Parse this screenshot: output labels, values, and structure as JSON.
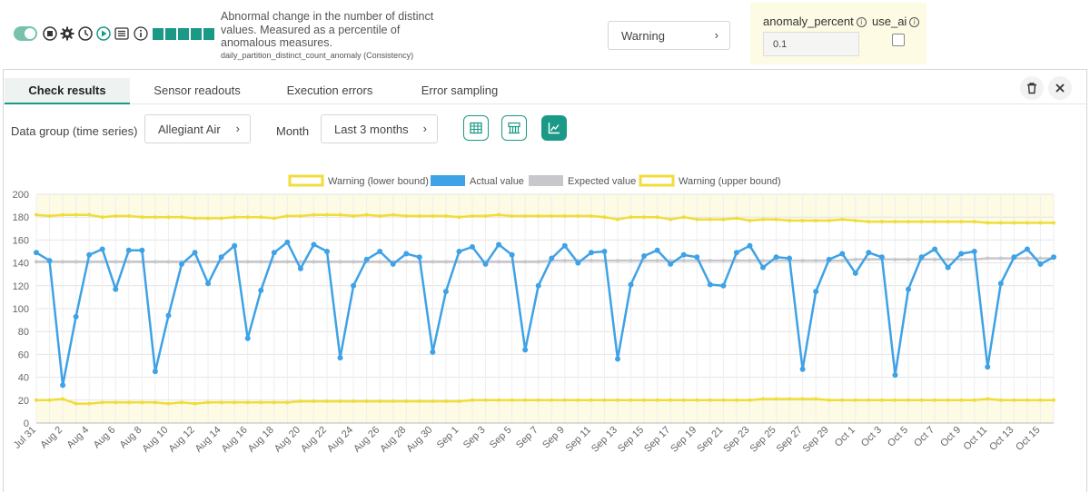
{
  "check": {
    "description": "Abnormal change in the number of distinct values. Measured as a percentile of anomalous measures.",
    "name": "daily_partition_distinct_count_anomaly",
    "category": "(Consistency)",
    "severity": "Warning",
    "params": [
      {
        "label": "anomaly_percent",
        "value": "0.1"
      },
      {
        "label": "use_ai"
      }
    ],
    "icons": [
      "toggle-on-icon",
      "stop-icon",
      "gear-icon",
      "clock-icon",
      "run-icon",
      "list-icon",
      "info-icon"
    ]
  },
  "tabs": [
    "Check results",
    "Sensor readouts",
    "Execution errors",
    "Error sampling"
  ],
  "filters": {
    "data_group_label": "Data group (time series)",
    "data_group_value": "Allegiant Air",
    "month_label": "Month",
    "month_value": "Last 3 months"
  },
  "colors": {
    "accent": "#1a9a86",
    "actual": "#3ea2e6",
    "expected": "#c8c8cc",
    "warning": "#f0dd3c",
    "band": "#fdfbe3"
  },
  "chart_data": {
    "type": "line",
    "legend": [
      "Warning (lower bound)",
      "Actual value",
      "Expected value",
      "Warning (upper bound)"
    ],
    "legend_position": "top",
    "ylim": [
      0,
      200
    ],
    "yticks": [
      0,
      20,
      40,
      60,
      80,
      100,
      120,
      140,
      160,
      180,
      200
    ],
    "grid": true,
    "x": [
      "Jul 31",
      "Aug 1",
      "Aug 2",
      "Aug 3",
      "Aug 4",
      "Aug 5",
      "Aug 6",
      "Aug 7",
      "Aug 8",
      "Aug 9",
      "Aug 10",
      "Aug 11",
      "Aug 12",
      "Aug 13",
      "Aug 14",
      "Aug 15",
      "Aug 16",
      "Aug 17",
      "Aug 18",
      "Aug 19",
      "Aug 20",
      "Aug 21",
      "Aug 22",
      "Aug 23",
      "Aug 24",
      "Aug 25",
      "Aug 26",
      "Aug 27",
      "Aug 28",
      "Aug 29",
      "Aug 30",
      "Aug 31",
      "Sep 1",
      "Sep 2",
      "Sep 3",
      "Sep 4",
      "Sep 5",
      "Sep 6",
      "Sep 7",
      "Sep 8",
      "Sep 9",
      "Sep 10",
      "Sep 11",
      "Sep 12",
      "Sep 13",
      "Sep 14",
      "Sep 15",
      "Sep 16",
      "Sep 17",
      "Sep 18",
      "Sep 19",
      "Sep 20",
      "Sep 21",
      "Sep 22",
      "Sep 23",
      "Sep 24",
      "Sep 25",
      "Sep 26",
      "Sep 27",
      "Sep 28",
      "Sep 29",
      "Sep 30",
      "Oct 1",
      "Oct 2",
      "Oct 3",
      "Oct 4",
      "Oct 5",
      "Oct 6",
      "Oct 7",
      "Oct 8",
      "Oct 9",
      "Oct 10",
      "Oct 11",
      "Oct 12",
      "Oct 13",
      "Oct 14",
      "Oct 15",
      "Oct 16"
    ],
    "x_tick_labels": [
      "Jul 31",
      "Aug 2",
      "Aug 4",
      "Aug 6",
      "Aug 8",
      "Aug 10",
      "Aug 12",
      "Aug 14",
      "Aug 16",
      "Aug 18",
      "Aug 20",
      "Aug 22",
      "Aug 24",
      "Aug 26",
      "Aug 28",
      "Aug 30",
      "Sep 1",
      "Sep 3",
      "Sep 5",
      "Sep 7",
      "Sep 9",
      "Sep 11",
      "Sep 13",
      "Sep 15",
      "Sep 17",
      "Sep 19",
      "Sep 21",
      "Sep 23",
      "Sep 25",
      "Sep 27",
      "Sep 29",
      "Oct 1",
      "Oct 3",
      "Oct 5",
      "Oct 7",
      "Oct 9",
      "Oct 11",
      "Oct 13",
      "Oct 15"
    ],
    "series": [
      {
        "name": "Warning (lower bound)",
        "values": [
          20,
          20,
          21,
          17,
          17,
          18,
          18,
          18,
          18,
          18,
          17,
          18,
          17,
          18,
          18,
          18,
          18,
          18,
          18,
          18,
          19,
          19,
          19,
          19,
          19,
          19,
          19,
          19,
          19,
          19,
          19,
          19,
          19,
          20,
          20,
          20,
          20,
          20,
          20,
          20,
          20,
          20,
          20,
          20,
          20,
          20,
          20,
          20,
          20,
          20,
          20,
          20,
          20,
          20,
          20,
          21,
          21,
          21,
          21,
          21,
          20,
          20,
          20,
          20,
          20,
          20,
          20,
          20,
          20,
          20,
          20,
          20,
          21,
          20,
          20,
          20,
          20,
          20
        ]
      },
      {
        "name": "Actual value",
        "values": [
          149,
          142,
          33,
          93,
          147,
          152,
          117,
          151,
          151,
          45,
          94,
          139,
          149,
          122,
          145,
          155,
          74,
          116,
          149,
          158,
          135,
          156,
          150,
          57,
          120,
          143,
          150,
          139,
          148,
          145,
          62,
          115,
          150,
          154,
          139,
          156,
          147,
          64,
          120,
          144,
          155,
          140,
          149,
          150,
          56,
          121,
          146,
          151,
          139,
          147,
          145,
          121,
          120,
          149,
          155,
          136,
          145,
          144,
          47,
          115,
          143,
          148,
          131,
          149,
          145,
          42,
          117,
          145,
          152,
          136,
          148,
          150,
          49,
          122,
          145,
          152,
          139,
          145
        ]
      },
      {
        "name": "Expected value",
        "values": [
          141,
          141,
          141,
          141,
          141,
          141,
          141,
          141,
          141,
          141,
          141,
          141,
          141,
          141,
          141,
          141,
          141,
          141,
          141,
          141,
          141,
          141,
          141,
          141,
          141,
          141,
          141,
          141,
          141,
          141,
          141,
          141,
          141,
          141,
          141,
          141,
          141,
          141,
          141,
          142,
          142,
          142,
          142,
          142,
          142,
          142,
          142,
          142,
          142,
          142,
          142,
          142,
          142,
          142,
          142,
          142,
          142,
          142,
          142,
          142,
          142,
          142,
          143,
          143,
          143,
          143,
          143,
          143,
          143,
          143,
          143,
          143,
          144,
          144,
          144,
          144,
          144,
          144
        ]
      },
      {
        "name": "Warning (upper bound)",
        "values": [
          182,
          181,
          182,
          182,
          182,
          180,
          181,
          181,
          180,
          180,
          180,
          180,
          179,
          179,
          179,
          180,
          180,
          180,
          179,
          181,
          181,
          182,
          182,
          182,
          181,
          182,
          181,
          182,
          181,
          181,
          181,
          181,
          180,
          181,
          181,
          182,
          181,
          181,
          181,
          181,
          181,
          181,
          181,
          180,
          178,
          180,
          180,
          180,
          178,
          180,
          178,
          178,
          178,
          179,
          177,
          178,
          178,
          177,
          177,
          177,
          177,
          178,
          177,
          176,
          176,
          176,
          176,
          176,
          176,
          176,
          176,
          176,
          175,
          175,
          175,
          175,
          175,
          175
        ]
      }
    ]
  }
}
